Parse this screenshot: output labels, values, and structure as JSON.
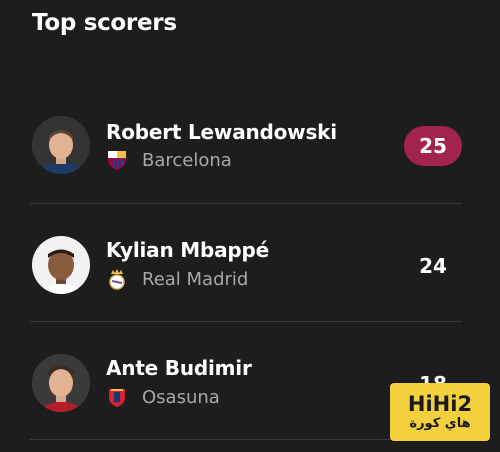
{
  "widget": {
    "title": "Top scorers"
  },
  "players": [
    {
      "name": "Robert Lewandowski",
      "club": "Barcelona",
      "goals": "25",
      "club_icon": "barcelona-crest-icon",
      "leader": true
    },
    {
      "name": "Kylian Mbappé",
      "club": "Real Madrid",
      "goals": "24",
      "club_icon": "real-madrid-crest-icon",
      "leader": false
    },
    {
      "name": "Ante Budimir",
      "club": "Osasuna",
      "goals": "18",
      "club_icon": "osasuna-crest-icon",
      "leader": false
    }
  ],
  "watermark": {
    "brand": "HiHi2",
    "arabic": "هاي كورة"
  },
  "colors": {
    "background": "#1d1d1d",
    "leader_badge": "#a3234f",
    "watermark_bg": "#f3d03e"
  }
}
